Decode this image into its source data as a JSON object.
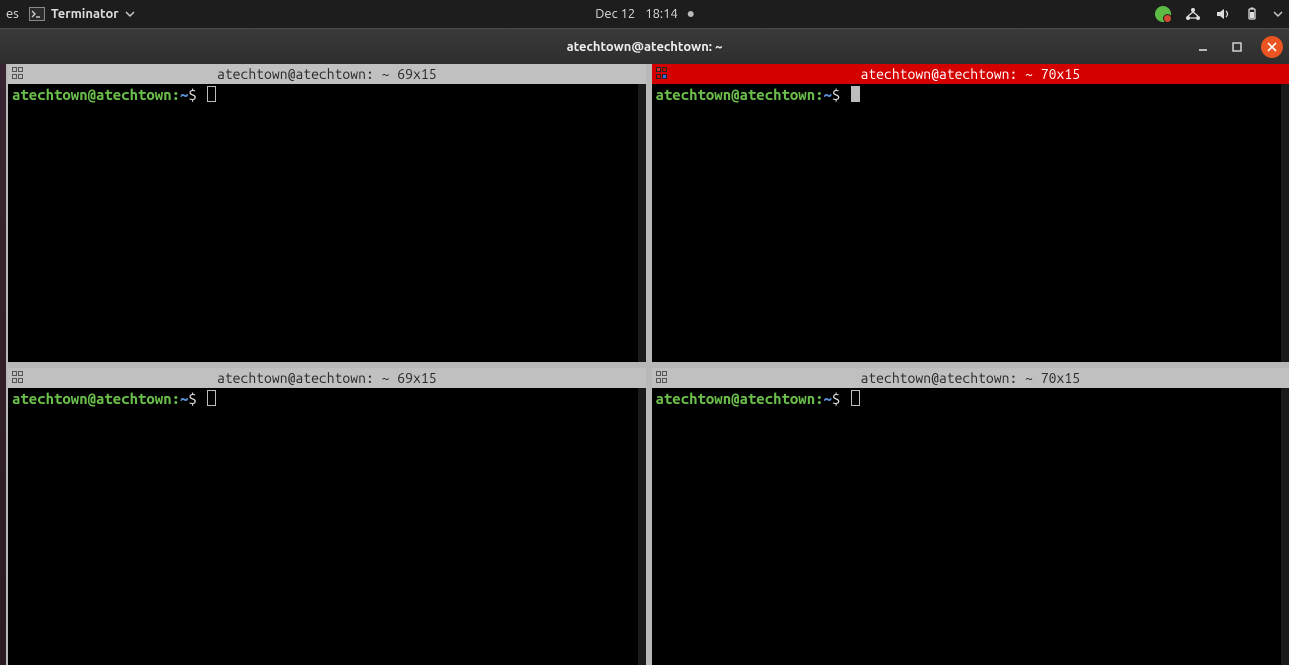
{
  "topbar": {
    "activities_fragment": "es",
    "app_name": "Terminator",
    "date": "Dec 12",
    "time": "18:14"
  },
  "window": {
    "title": "atechtown@atechtown: ~"
  },
  "panes": [
    {
      "title": "atechtown@atechtown: ~ 69x15",
      "active": false,
      "grp_variant": "plain",
      "prompt_user": "atechtown@atechtown",
      "prompt_path": "~",
      "prompt_symbol": "$",
      "cursor": "hollow"
    },
    {
      "title": "atechtown@atechtown: ~ 70x15",
      "active": true,
      "grp_variant": "redblue",
      "prompt_user": "atechtown@atechtown",
      "prompt_path": "~",
      "prompt_symbol": "$",
      "cursor": "solid"
    },
    {
      "title": "atechtown@atechtown: ~ 69x15",
      "active": false,
      "grp_variant": "plain",
      "prompt_user": "atechtown@atechtown",
      "prompt_path": "~",
      "prompt_symbol": "$",
      "cursor": "hollow"
    },
    {
      "title": "atechtown@atechtown: ~ 70x15",
      "active": false,
      "grp_variant": "plain",
      "prompt_user": "atechtown@atechtown",
      "prompt_path": "~",
      "prompt_symbol": "$",
      "cursor": "hollow"
    }
  ]
}
